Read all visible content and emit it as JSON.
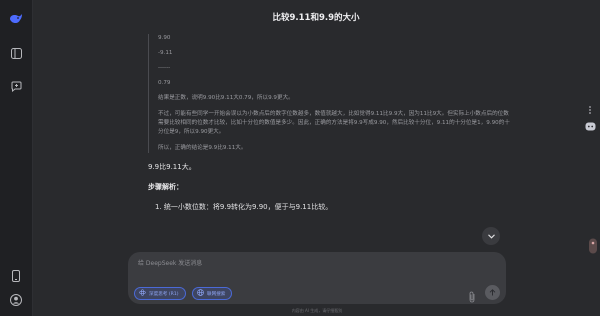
{
  "title": "比较9.11和9.9的大小",
  "think": {
    "calc": [
      "9.90",
      "-9.11",
      "------",
      "0.79"
    ],
    "conclusion": "结果是正数，说明9.90比9.11大0.79，所以9.9更大。",
    "summary1": "不过，可能有些同学一开始会误以为小数点后的数字位数越多，数值就越大，比如觉得9.11比9.9大，因为11比9大。但实际上小数点后的位数需要比较相同的位数才比较，比如十分位的数值是多少。因此，正确的方法是将9.9写成9.90，然后比较十分位，9.11的十分位是1，9.90的十分位是9，所以9.90更大。",
    "summary2": "所以，正确的结论是9.9比9.11大。"
  },
  "answer": "9.9比9.11大。",
  "steps_title": "步骤解析：",
  "step1": "1. 统一小数位数：将9.9转化为9.90，便于与9.11比较。",
  "input": {
    "placeholder": "给 DeepSeek 发送消息"
  },
  "chips": {
    "deep_think": "深度思考 (R1)",
    "web_search": "联网搜索"
  },
  "disclaimer": "内容由 AI 生成，请仔细甄别",
  "colors": {
    "accent": "#4d6bfe",
    "background": "#292a2d"
  }
}
